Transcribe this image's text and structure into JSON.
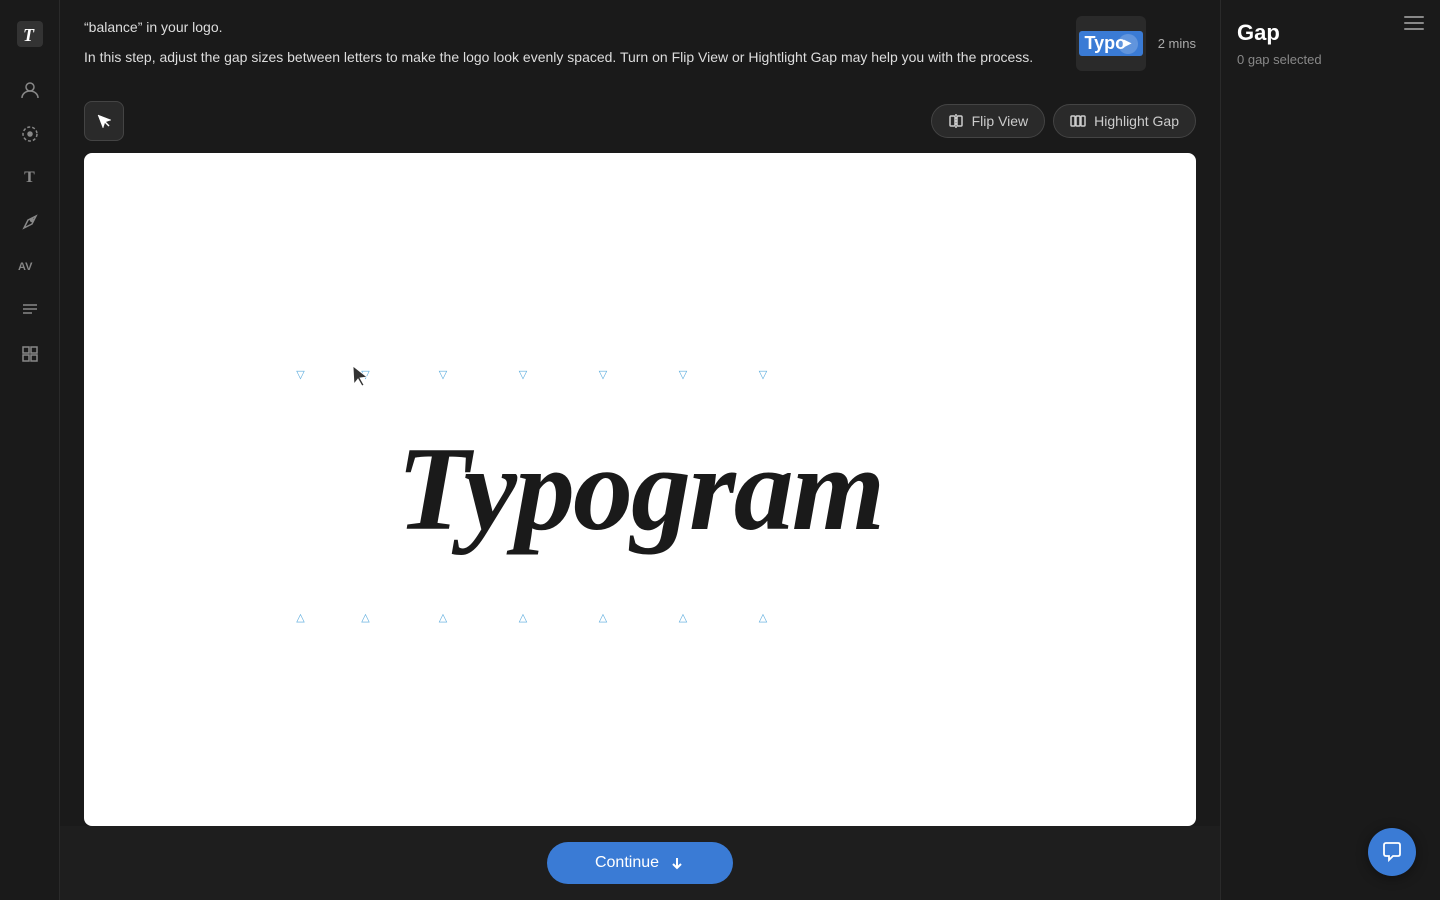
{
  "app": {
    "logo_label": "T"
  },
  "sidebar": {
    "icons": [
      {
        "name": "user-icon",
        "symbol": "👤"
      },
      {
        "name": "smiley-icon",
        "symbol": "😊"
      },
      {
        "name": "text-icon",
        "symbol": "T"
      },
      {
        "name": "pen-icon",
        "symbol": "✒"
      },
      {
        "name": "kerning-icon",
        "symbol": "AV"
      },
      {
        "name": "paragraph-icon",
        "symbol": "≡"
      },
      {
        "name": "grid-icon",
        "symbol": "▦"
      }
    ]
  },
  "top_info": {
    "description_line1": "“balance” in your logo.",
    "description_line2": "In this step, adjust the gap sizes between letters to make the logo look evenly spaced. Turn on Flip View or Hightlight Gap may help you with the process.",
    "video_thumb_text": "Typog",
    "video_duration": "2 mins"
  },
  "toolbar": {
    "flip_view_label": "Flip View",
    "highlight_gap_label": "Highlight Gap"
  },
  "canvas": {
    "logo_text": "Typogram"
  },
  "right_panel": {
    "title": "Gap",
    "subtitle": "0 gap selected"
  },
  "continue_bar": {
    "button_label": "Continue"
  },
  "colors": {
    "accent_blue": "#3a7bd5",
    "gap_marker_color": "#4a9fd5",
    "background": "#1a1a1a",
    "canvas_bg": "#ffffff",
    "text_dark": "#1a1a1a"
  }
}
